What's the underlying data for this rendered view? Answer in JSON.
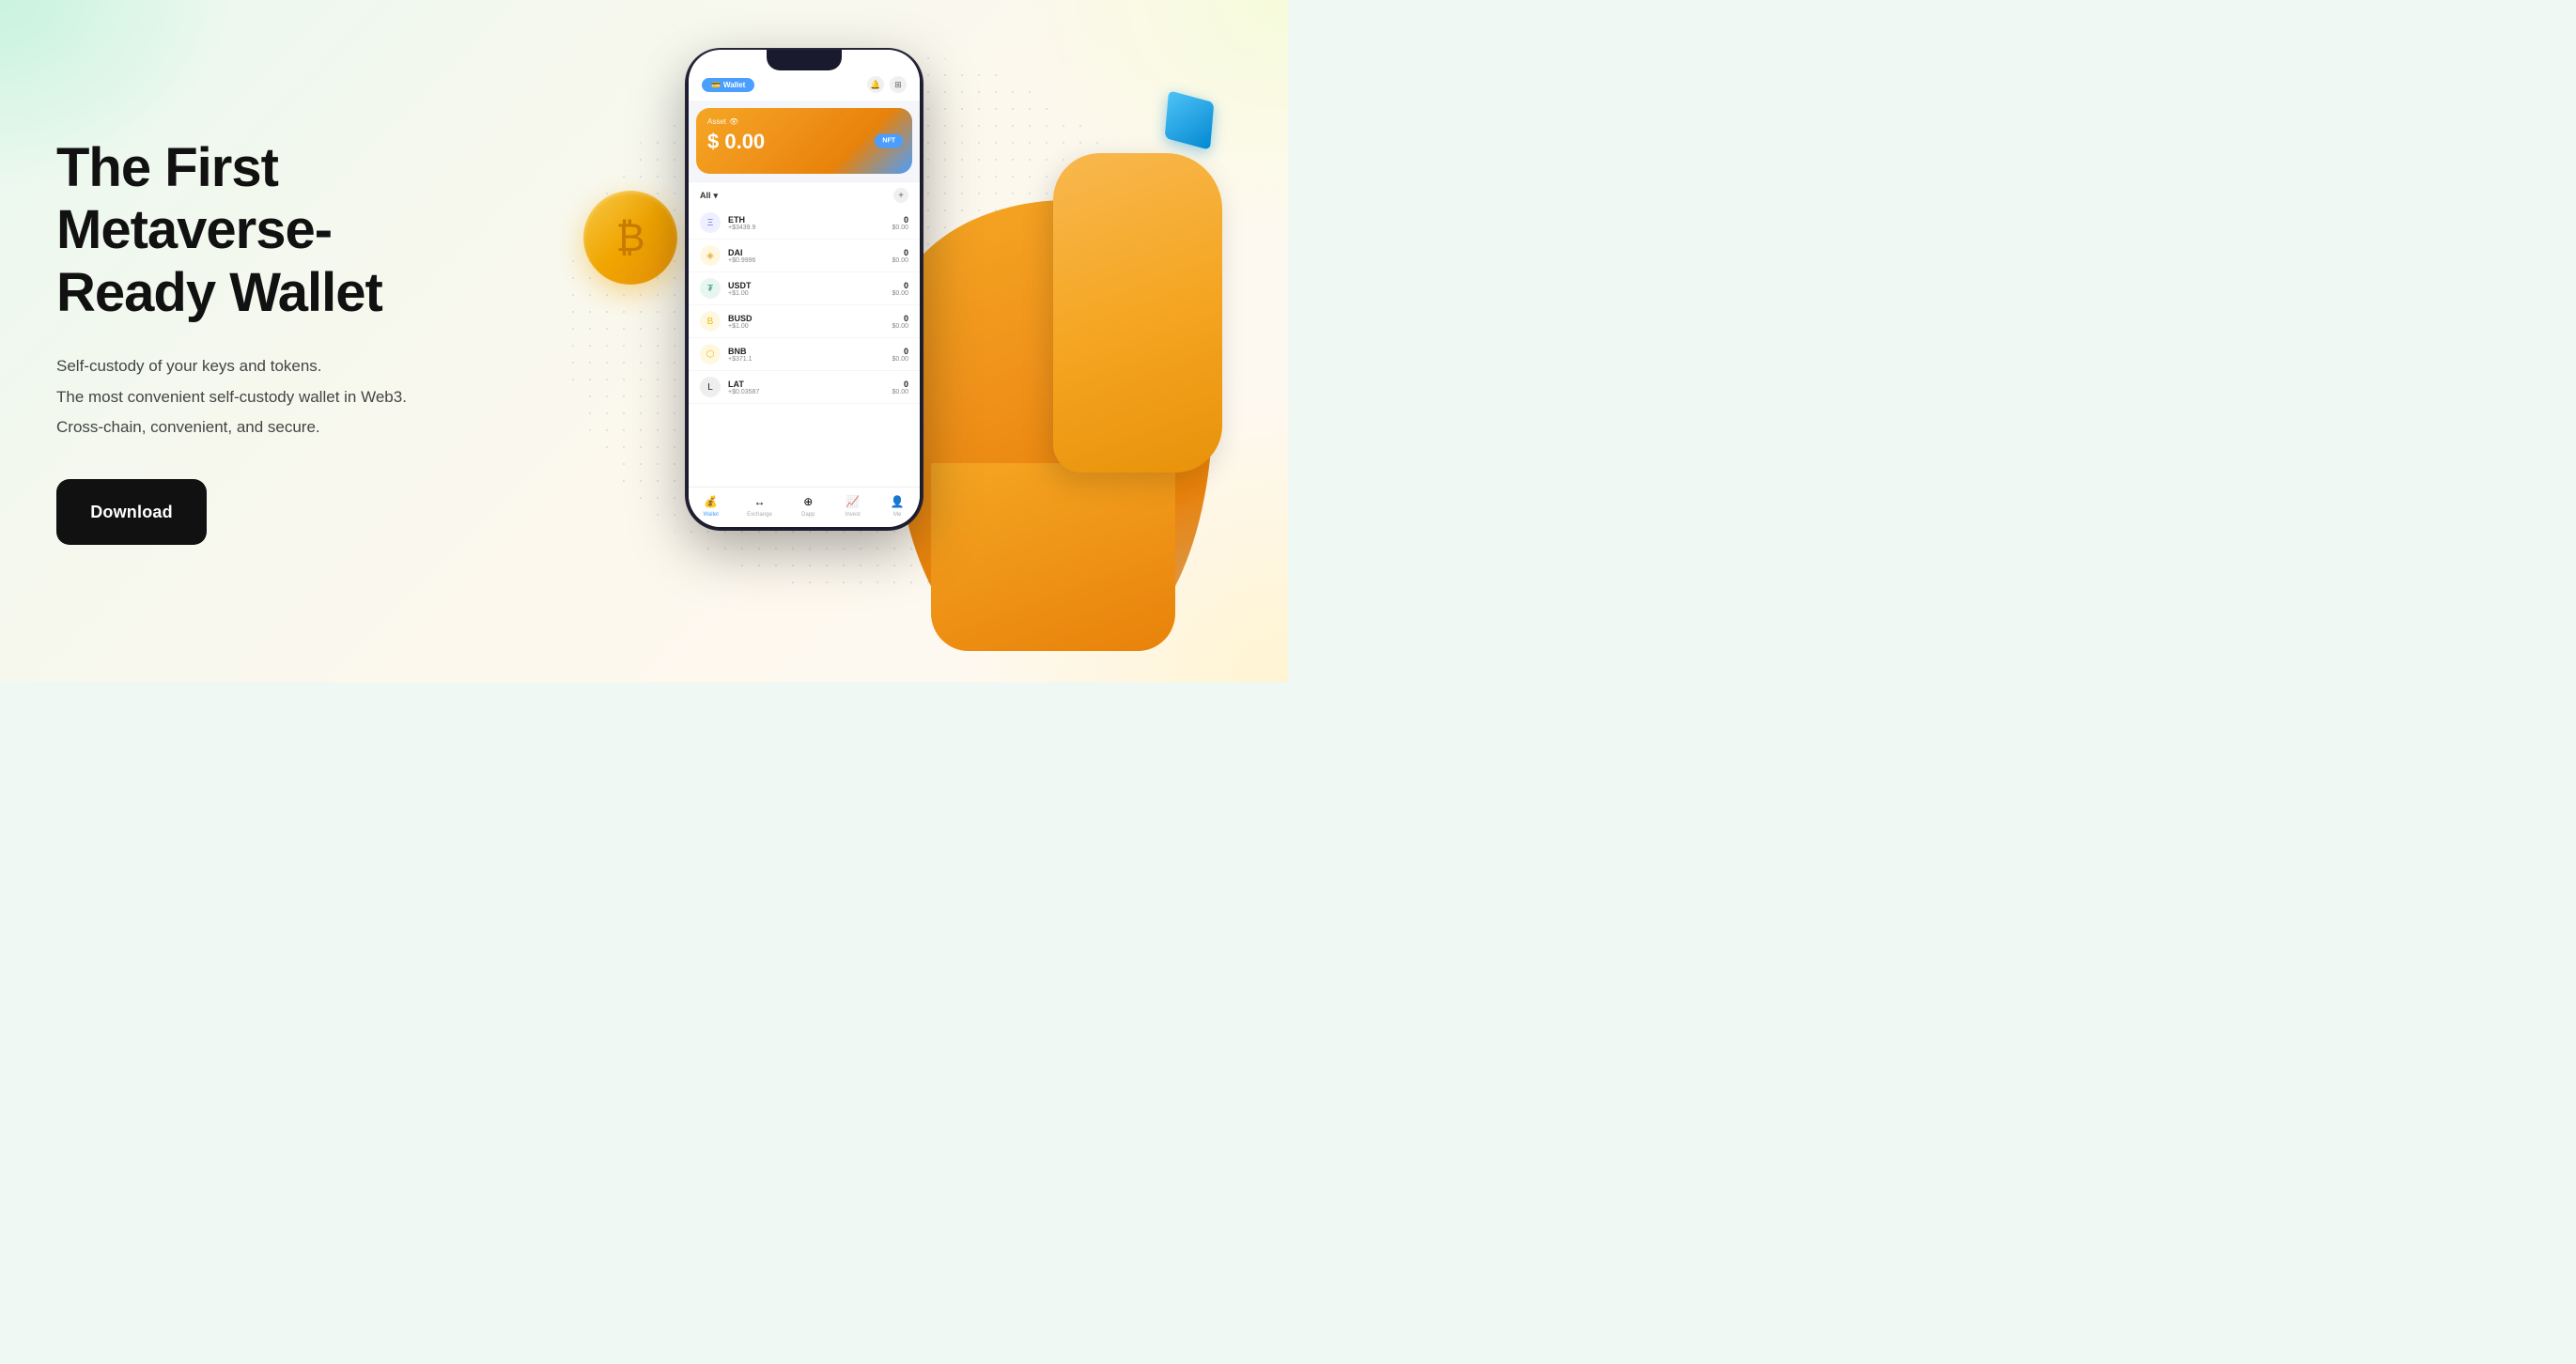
{
  "hero": {
    "title_line1": "The First Metaverse-",
    "title_line2": "Ready Wallet",
    "subtitle_lines": [
      "Self-custody of your keys and tokens.",
      "The most convenient self-custody wallet in Web3.",
      "Cross-chain, convenient, and secure."
    ],
    "download_button": "Download"
  },
  "app": {
    "header_tab": "Wallet",
    "asset_label": "Asset",
    "asset_amount": "$ 0.00",
    "nft_badge": "NFT",
    "filter_all": "All",
    "tokens": [
      {
        "symbol": "ETH",
        "price": "+$3439.9",
        "amount": "0",
        "value": "$0.00",
        "color": "#627EEA",
        "icon": "Ξ"
      },
      {
        "symbol": "DAI",
        "price": "+$0.9996",
        "amount": "0",
        "value": "$0.00",
        "color": "#F5AC37",
        "icon": "◈"
      },
      {
        "symbol": "USDT",
        "price": "+$1.00",
        "amount": "0",
        "value": "$0.00",
        "color": "#26A17B",
        "icon": "₮"
      },
      {
        "symbol": "BUSD",
        "price": "+$1.00",
        "amount": "0",
        "value": "$0.00",
        "color": "#F0B90B",
        "icon": "B"
      },
      {
        "symbol": "BNB",
        "price": "+$371.1",
        "amount": "0",
        "value": "$0.00",
        "color": "#F0B90B",
        "icon": "⬡"
      },
      {
        "symbol": "LAT",
        "price": "+$0.03587",
        "amount": "0",
        "value": "$0.00",
        "color": "#1a1a2e",
        "icon": "L"
      }
    ],
    "nav_items": [
      {
        "label": "Wallet",
        "active": true
      },
      {
        "label": "Exchange",
        "active": false
      },
      {
        "label": "DApp",
        "active": false
      },
      {
        "label": "Invest",
        "active": false
      },
      {
        "label": "Me",
        "active": false
      }
    ]
  },
  "colors": {
    "bg_start": "#e8f8f0",
    "bg_end": "#fff8f0",
    "button_bg": "#111111",
    "button_text": "#ffffff",
    "title_color": "#111111",
    "subtitle_color": "#444444"
  }
}
